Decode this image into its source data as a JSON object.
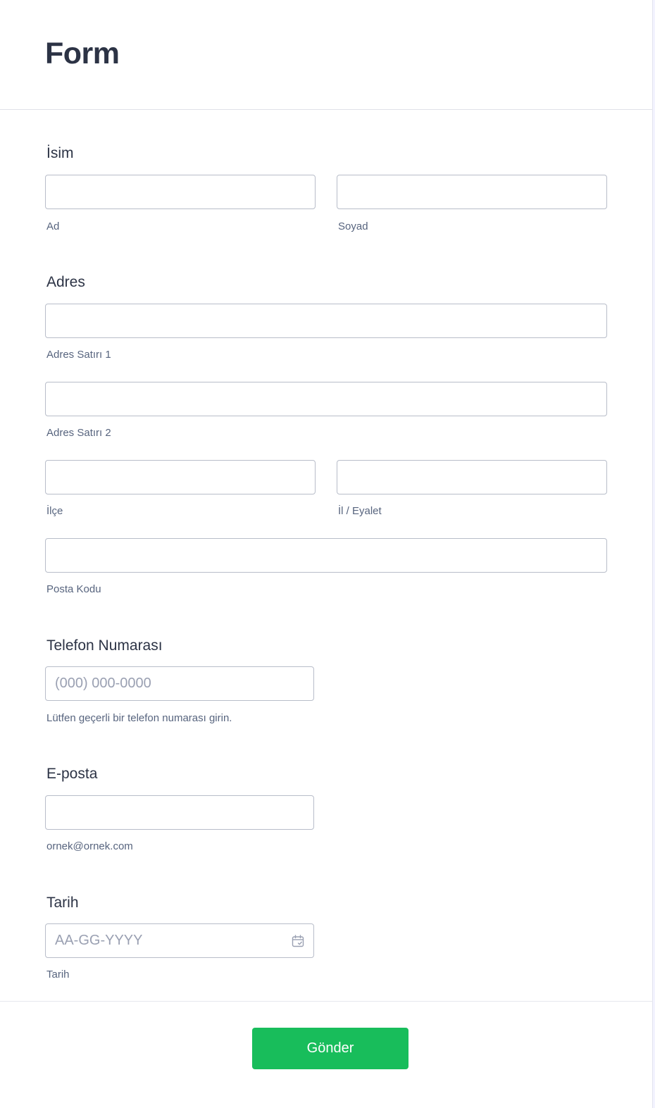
{
  "form": {
    "title": "Form",
    "name": {
      "label": "İsim",
      "first_sublabel": "Ad",
      "last_sublabel": "Soyad"
    },
    "address": {
      "label": "Adres",
      "line1_sublabel": "Adres Satırı 1",
      "line2_sublabel": "Adres Satırı 2",
      "district_sublabel": "İlçe",
      "state_sublabel": "İl / Eyalet",
      "postal_sublabel": "Posta Kodu"
    },
    "phone": {
      "label": "Telefon Numarası",
      "placeholder": "(000) 000-0000",
      "sublabel": "Lütfen geçerli bir telefon numarası girin."
    },
    "email": {
      "label": "E-posta",
      "sublabel": "ornek@ornek.com"
    },
    "date": {
      "label": "Tarih",
      "placeholder": "AA-GG-YYYY",
      "sublabel": "Tarih",
      "icon": "calendar-icon"
    },
    "submit_label": "Gönder"
  },
  "colors": {
    "submit": "#18bd5b",
    "text": "#2c3345",
    "border": "#b8bdc9"
  }
}
